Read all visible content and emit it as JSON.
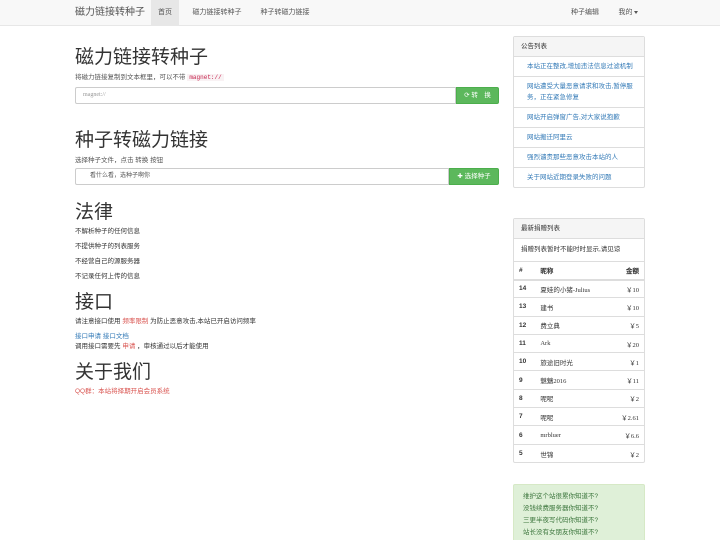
{
  "navbar": {
    "brand": "磁力链接转种子",
    "tabs": [
      {
        "label": "首页",
        "active": true
      },
      {
        "label": "磁力链接转种子",
        "active": false
      },
      {
        "label": "种子转磁力链接",
        "active": false
      }
    ],
    "right": {
      "edit": "种子编辑",
      "mine": "我的"
    }
  },
  "magnet_section": {
    "title": "磁力链接转种子",
    "hint_prefix": "将磁力链接复制到文本框里，可以不带",
    "hint_code": "magnet://",
    "input_placeholder": "magnet://",
    "button_icon": "refresh-icon",
    "button_label": "转　换"
  },
  "torrent_section": {
    "title": "种子转磁力链接",
    "hint": "选择种子文件，点击 转换 按钮",
    "file_text": "看什么看，选种子啊你",
    "button_label": "选择种子"
  },
  "law_section": {
    "title": "法律",
    "items": [
      "不解析种子的任何信息",
      "不提供种子的列表服务",
      "不经营自己的源服务器",
      "不记录任何上传的信息"
    ]
  },
  "api_section": {
    "title": "接口",
    "line1_prefix": "请注意接口使用",
    "line1_highlight": "频率限制",
    "line1_suffix": "为防止恶意攻击,本站已开启访问频率",
    "link1": "接口申请",
    "link2": "接口文档",
    "line3_prefix": "调用接口需要先",
    "line3_highlight": "申请",
    "line3_suffix": "，审核通过以后才能使用"
  },
  "about_section": {
    "title": "关于我们",
    "qq_text": "QQ群：本站将择期开启会员系统"
  },
  "notices": {
    "heading": "公告列表",
    "items": [
      "本站正在整改,增加违法信息过滤机制",
      "网站遭受大量恶意请求和攻击,暂停服务，正在紧急修复",
      "网站开启弹窗广告,对大家说抱歉",
      "网站搬迁阿里云",
      "强烈谴责那些恶意攻击本站的人",
      "关于网站近期登录失败的问题"
    ]
  },
  "donations": {
    "heading": "最新捐赠列表",
    "notice": "捐赠列表暂时不能时时显示,请见谅",
    "columns": [
      "#",
      "昵称",
      "金额"
    ],
    "rows": [
      {
        "id": "14",
        "name": "夏娃的小猪-Julius",
        "amount": "￥10"
      },
      {
        "id": "13",
        "name": "建书",
        "amount": "￥10"
      },
      {
        "id": "12",
        "name": "费立典",
        "amount": "￥5"
      },
      {
        "id": "11",
        "name": "Ark",
        "amount": "￥20"
      },
      {
        "id": "10",
        "name": "旅途旧时光",
        "amount": "￥1"
      },
      {
        "id": "9",
        "name": "魅魑2016",
        "amount": "￥11"
      },
      {
        "id": "8",
        "name": "呢呢",
        "amount": "￥2"
      },
      {
        "id": "7",
        "name": "呢呢",
        "amount": "￥2.61"
      },
      {
        "id": "6",
        "name": "mrbluer",
        "amount": "￥6.6"
      },
      {
        "id": "5",
        "name": "世锦",
        "amount": "￥2"
      }
    ]
  },
  "support": {
    "lines": [
      "维护这个站很累你知道不?",
      "没钱续费服务器你知道不?",
      "三更半夜写代码你知道不?",
      "站长没有女朋友你知道不?"
    ]
  },
  "colors": {
    "primary_green": "#5cb85c",
    "link_blue": "#337ab7",
    "danger_red": "#d9534f"
  }
}
